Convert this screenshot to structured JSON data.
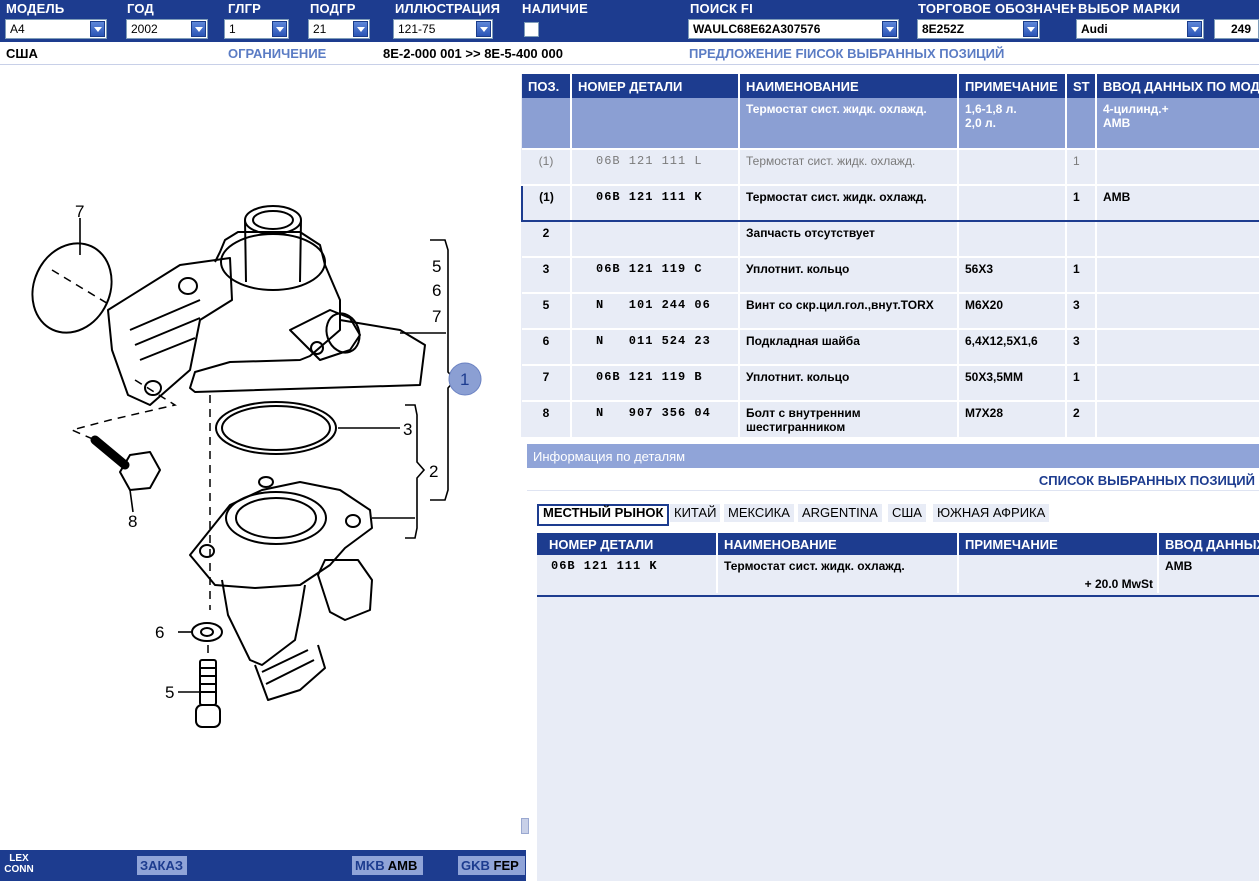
{
  "header": {
    "fields": [
      {
        "label": "МОДЕЛЬ",
        "value": "A4"
      },
      {
        "label": "ГОД",
        "value": "2002"
      },
      {
        "label": "ГЛГР",
        "value": "1"
      },
      {
        "label": "ПОДГР",
        "value": "21"
      },
      {
        "label": "ИЛЛЮСТРАЦИЯ",
        "value": "121-75"
      },
      {
        "label": "НАЛИЧИЕ",
        "value": ""
      },
      {
        "label": "ПОИСК FI",
        "value": "WAULC68E62A307576"
      },
      {
        "label": "ТОРГОВОЕ ОБОЗНАЧЕНИЕ",
        "value": "8E252Z"
      },
      {
        "label": "ВЫБОР МАРКИ",
        "value": "Audi"
      }
    ],
    "page_number": "249"
  },
  "subheader": {
    "region": "США",
    "restriction_label": "ОГРАНИЧЕНИЕ",
    "restriction_value": "8E-2-000 001 >> 8E-5-400 000",
    "proposal": "ПРЕДЛОЖЕНИЕ FIИСОК ВЫБРАННЫХ ПОЗИЦИЙ"
  },
  "parts_table": {
    "columns": [
      "ПОЗ.",
      "НОМЕР ДЕТАЛИ",
      "НАИМЕНОВАНИЕ",
      "ПРИМЕЧАНИЕ",
      "ST",
      "ВВОД ДАННЫХ ПО МОДЕЛ"
    ],
    "group_row": {
      "pos": "",
      "part": "",
      "name": "Термостат сист. жидк. охлажд.",
      "note": "1,6-1,8 л.\n2,0 л.",
      "st": "",
      "model": "4-цилинд.+\nAMB"
    },
    "rows": [
      {
        "pos": "(1)",
        "part": "06B 121 111 L",
        "name": "Термостат сист. жидк. охлажд.",
        "note": "",
        "st": "1",
        "model": "",
        "style": "grey"
      },
      {
        "pos": "(1)",
        "part": "06B 121 111 K",
        "name": "Термостат сист. жидк. охлажд.",
        "note": "",
        "st": "1",
        "model": "AMB",
        "style": "selected"
      },
      {
        "pos": "2",
        "part": "",
        "name": "Запчасть отсутствует",
        "note": "",
        "st": "",
        "model": "",
        "style": ""
      },
      {
        "pos": "3",
        "part": "06B 121 119 C",
        "name": "Уплотнит. кольцо",
        "note": "56X3",
        "st": "1",
        "model": "",
        "style": ""
      },
      {
        "pos": "5",
        "part": "N   101 244 06",
        "name": "Винт со скр.цил.гол.,внут.TORX",
        "note": "M6X20",
        "st": "3",
        "model": "",
        "style": ""
      },
      {
        "pos": "6",
        "part": "N   011 524 23",
        "name": "Подкладная шайба",
        "note": "6,4X12,5X1,6",
        "st": "3",
        "model": "",
        "style": ""
      },
      {
        "pos": "7",
        "part": "06B 121 119 B",
        "name": "Уплотнит. кольцо",
        "note": "50X3,5MM",
        "st": "1",
        "model": "",
        "style": ""
      },
      {
        "pos": "8",
        "part": "N   907 356 04",
        "name": "Болт с внутренним шестигранником",
        "note": "M7X28",
        "st": "2",
        "model": "",
        "style": ""
      }
    ]
  },
  "info_panel": {
    "title": "Информация по деталям",
    "bar_label": "СПИСОК ВЫБРАННЫХ ПОЗИЦИЙ",
    "tabs": [
      "МЕСТНЫЙ РЫНОК",
      "КИТАЙ",
      "МЕКСИКА",
      "ARGENTINA",
      "США",
      "ЮЖНАЯ АФРИКА"
    ],
    "columns": [
      "НОМЕР ДЕТАЛИ",
      "НАИМЕНОВАНИЕ",
      "ПРИМЕЧАНИЕ",
      "ВВОД ДАННЫХ"
    ],
    "row": {
      "part": "06B 121 111 K",
      "name": "Термостат сист. жидк. охлажд.",
      "note": "+ 20.0 MwSt",
      "model": "AMB"
    }
  },
  "diagram": {
    "callouts": [
      "7",
      "5",
      "6",
      "7",
      "1",
      "3",
      "2",
      "8",
      "6",
      "5"
    ]
  },
  "bottom_bar": {
    "logo": "LEX\nCONN",
    "order": "ЗАКАЗ",
    "mkb_label": "MKB",
    "mkb_value": "AMB",
    "gkb_label": "GKB",
    "gkb_value": "FEP"
  },
  "colors": {
    "primary": "#1d3c8f",
    "light": "#90a4d8",
    "row_bg": "#e8ecf6",
    "group": "#8b9fd3"
  }
}
